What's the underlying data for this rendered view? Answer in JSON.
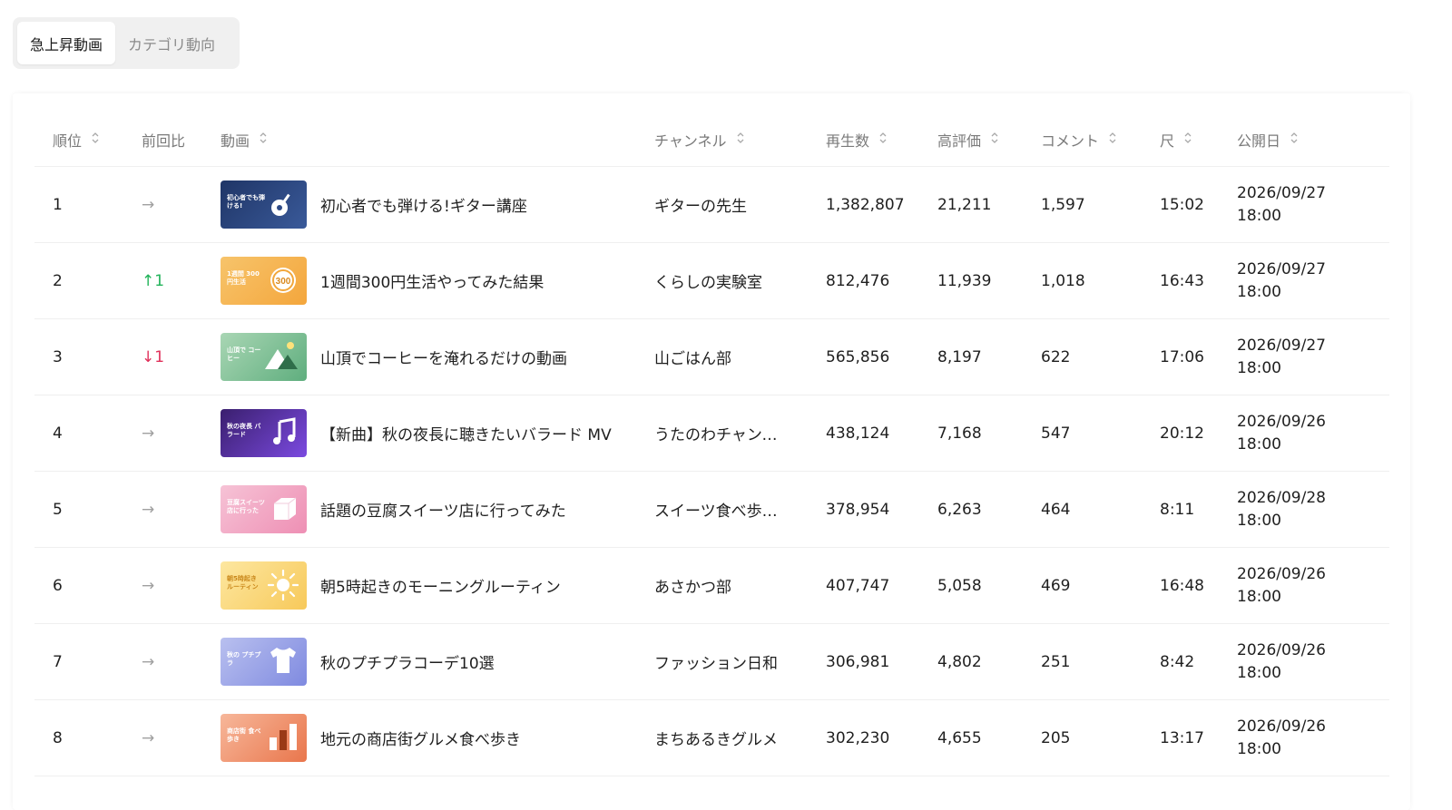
{
  "tabs": [
    {
      "label": "急上昇動画",
      "active": true
    },
    {
      "label": "カテゴリ動向",
      "active": false
    }
  ],
  "columns": {
    "rank": "順位",
    "delta": "前回比",
    "video": "動画",
    "channel": "チャンネル",
    "views": "再生数",
    "likes": "高評価",
    "comments": "コメント",
    "duration": "尺",
    "published": "公開日"
  },
  "rows": [
    {
      "rank": "1",
      "delta": "→",
      "title": "初心者でも弾ける!ギター講座",
      "thumb_text": "初心者でも弾ける!",
      "thumb_icon": "guitar-icon",
      "channel": "ギターの先生",
      "views": "1,382,807",
      "likes": "21,211",
      "comments": "1,597",
      "duration": "15:02",
      "date": "2026/09/27",
      "time": "18:00"
    },
    {
      "rank": "2",
      "delta": "↑1",
      "title": "1週間300円生活やってみた結果",
      "thumb_text": "1週間 300円生活",
      "thumb_icon": "coin-icon",
      "channel": "くらしの実験室",
      "views": "812,476",
      "likes": "11,939",
      "comments": "1,018",
      "duration": "16:43",
      "date": "2026/09/27",
      "time": "18:00"
    },
    {
      "rank": "3",
      "delta": "↓1",
      "title": "山頂でコーヒーを淹れるだけの動画",
      "thumb_text": "山頂で コーヒー",
      "thumb_icon": "mountain-icon",
      "channel": "山ごはん部",
      "views": "565,856",
      "likes": "8,197",
      "comments": "622",
      "duration": "17:06",
      "date": "2026/09/27",
      "time": "18:00"
    },
    {
      "rank": "4",
      "delta": "→",
      "title": "【新曲】秋の夜長に聴きたいバラード MV",
      "thumb_text": "秋の夜長 バラード",
      "thumb_icon": "music-note-icon",
      "channel": "うたのわチャンネル",
      "views": "438,124",
      "likes": "7,168",
      "comments": "547",
      "duration": "20:12",
      "date": "2026/09/26",
      "time": "18:00"
    },
    {
      "rank": "5",
      "delta": "→",
      "title": "話題の豆腐スイーツ店に行ってみた",
      "thumb_text": "豆腐スイーツ 店に行った",
      "thumb_icon": "tofu-cube-icon",
      "channel": "スイーツ食べ歩き…",
      "views": "378,954",
      "likes": "6,263",
      "comments": "464",
      "duration": "8:11",
      "date": "2026/09/28",
      "time": "18:00"
    },
    {
      "rank": "6",
      "delta": "→",
      "title": "朝5時起きのモーニングルーティン",
      "thumb_text": "朝5時起き ルーティン",
      "thumb_icon": "sun-icon",
      "channel": "あさかつ部",
      "views": "407,747",
      "likes": "5,058",
      "comments": "469",
      "duration": "16:48",
      "date": "2026/09/26",
      "time": "18:00"
    },
    {
      "rank": "7",
      "delta": "→",
      "title": "秋のプチプラコーデ10選",
      "thumb_text": "秋の プチプラ",
      "thumb_icon": "tshirt-icon",
      "channel": "ファッション日和",
      "views": "306,981",
      "likes": "4,802",
      "comments": "251",
      "duration": "8:42",
      "date": "2026/09/26",
      "time": "18:00"
    },
    {
      "rank": "8",
      "delta": "→",
      "title": "地元の商店街グルメ食べ歩き",
      "thumb_text": "商店街 食べ歩き",
      "thumb_icon": "bar-chart-icon",
      "channel": "まちあるきグルメ",
      "views": "302,230",
      "likes": "4,655",
      "comments": "205",
      "duration": "13:17",
      "date": "2026/09/26",
      "time": "18:00"
    }
  ],
  "colors": {
    "up": "#22b35a",
    "down": "#e0305a",
    "flat": "#a0a0a0",
    "thumb_gradients": [
      [
        "#1f3566",
        "#3a5a9a"
      ],
      [
        "#f7c46b",
        "#f4a63c"
      ],
      [
        "#a9d6b4",
        "#5fae7e"
      ],
      [
        "#3a1f6e",
        "#7b4ae0"
      ],
      [
        "#f6c3d6",
        "#ee8fb4"
      ],
      [
        "#fde7a0",
        "#f7c95a"
      ],
      [
        "#b9c0ef",
        "#7f8ae0"
      ],
      [
        "#f7b79a",
        "#e9764c"
      ]
    ],
    "thumb_text": [
      "#ffffff",
      "#ffffff",
      "#ffffff",
      "#ffffff",
      "#ffffff",
      "#c9871a",
      "#ffffff",
      "#ffffff"
    ]
  }
}
